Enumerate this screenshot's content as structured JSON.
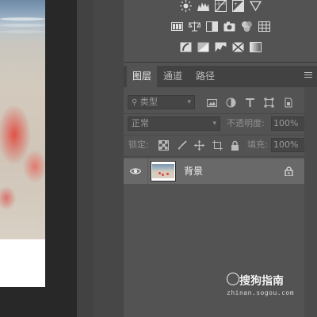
{
  "canvas": {
    "image": "beach-photo"
  },
  "adjustments": {
    "row1_icons": [
      "brightness-icon",
      "levels-icon",
      "curves-icon",
      "exposure-icon",
      "vibrance-icon"
    ],
    "row2_icons": [
      "color-balance-icon",
      "scales-icon",
      "black-white-icon",
      "photo-filter-icon",
      "channel-mixer-icon",
      "color-lookup-icon"
    ],
    "row3_icons": [
      "invert-icon",
      "posterize-icon",
      "threshold-icon",
      "selective-color-icon",
      "gradient-map-icon"
    ]
  },
  "layers_panel": {
    "tabs": [
      "图层",
      "通道",
      "路径"
    ],
    "active_tab": "图层",
    "filter": {
      "label": "类型",
      "icons": [
        "pixel-filter-icon",
        "adjustment-filter-icon",
        "type-filter-icon",
        "shape-filter-icon",
        "smart-object-filter-icon"
      ]
    },
    "blend_mode": "正常",
    "opacity_label": "不透明度:",
    "opacity_value": "100%",
    "lock_label": "锁定:",
    "fill_label": "填充:",
    "fill_value": "100%",
    "layers": [
      {
        "name": "背景",
        "visible": true,
        "locked": true
      }
    ]
  },
  "watermark": {
    "text": "搜狗指南",
    "url": "zhinan.sogou.com"
  },
  "colors": {
    "panel": "#535353",
    "tab_bar": "#424242",
    "selected_layer": "#696969",
    "workspace": "#282828"
  }
}
